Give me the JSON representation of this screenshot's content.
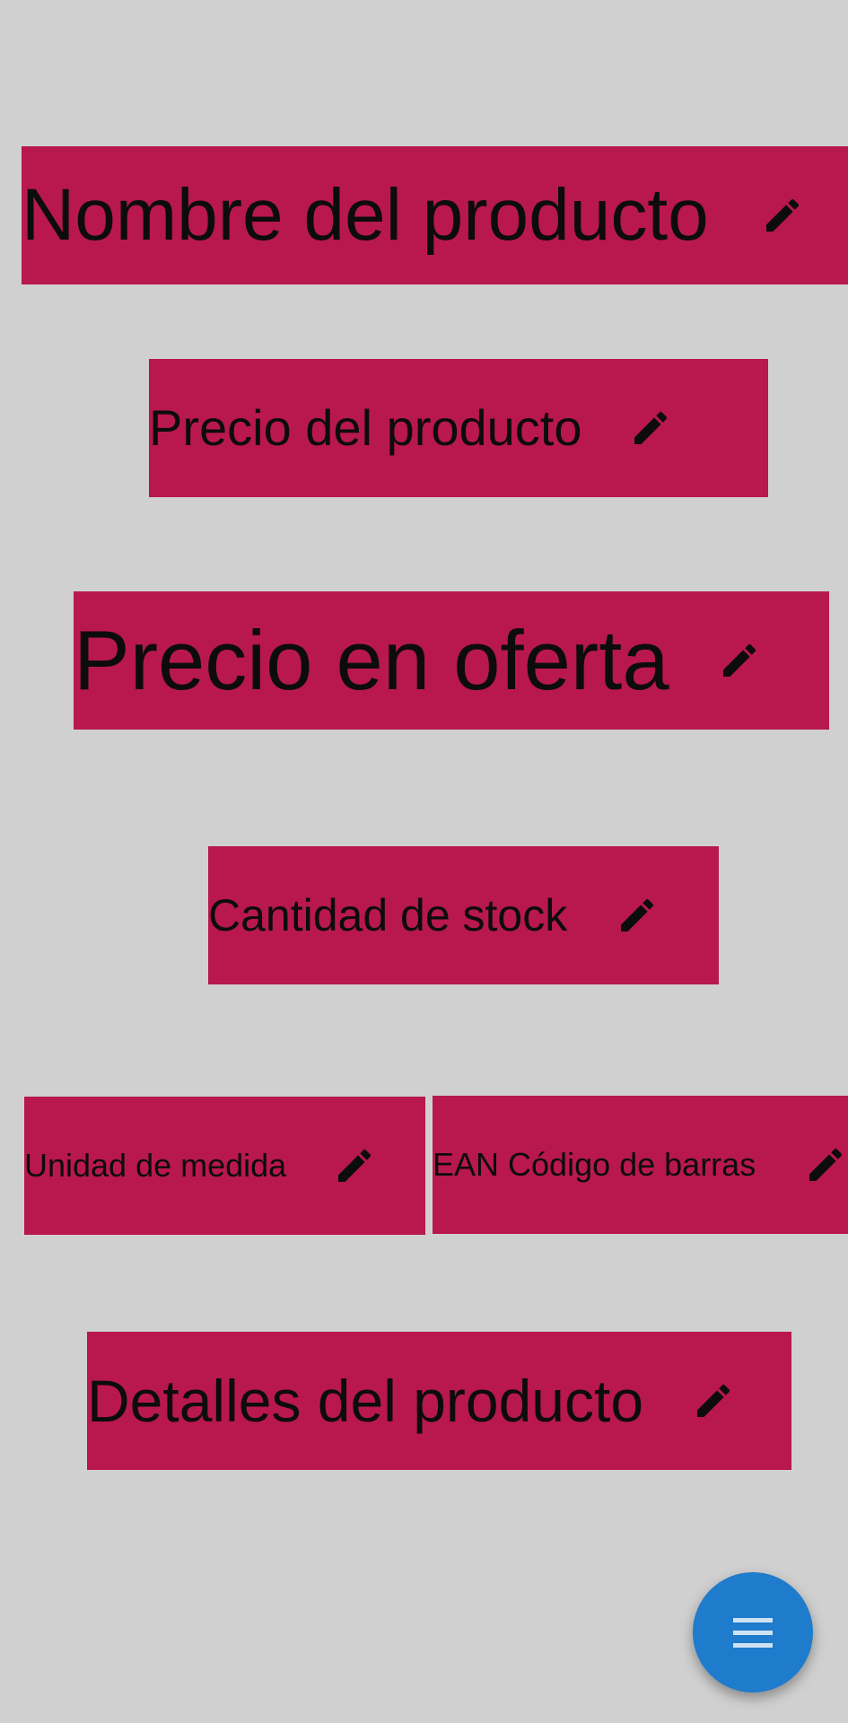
{
  "fields": [
    {
      "id": "nombre",
      "label": "Nombre del producto"
    },
    {
      "id": "precio",
      "label": "Precio del producto"
    },
    {
      "id": "oferta",
      "label": "Precio en oferta"
    },
    {
      "id": "stock",
      "label": "Cantidad de stock"
    },
    {
      "id": "unidad",
      "label": "Unidad de medida"
    },
    {
      "id": "ean",
      "label": "EAN Código de barras"
    },
    {
      "id": "detalles",
      "label": "Detalles del producto"
    }
  ],
  "icons": {
    "edit": "pencil-icon",
    "fab": "menu-icon"
  },
  "colors": {
    "background": "#d0d0d0",
    "field": "#b8184e",
    "fab": "#1f7bcb"
  }
}
